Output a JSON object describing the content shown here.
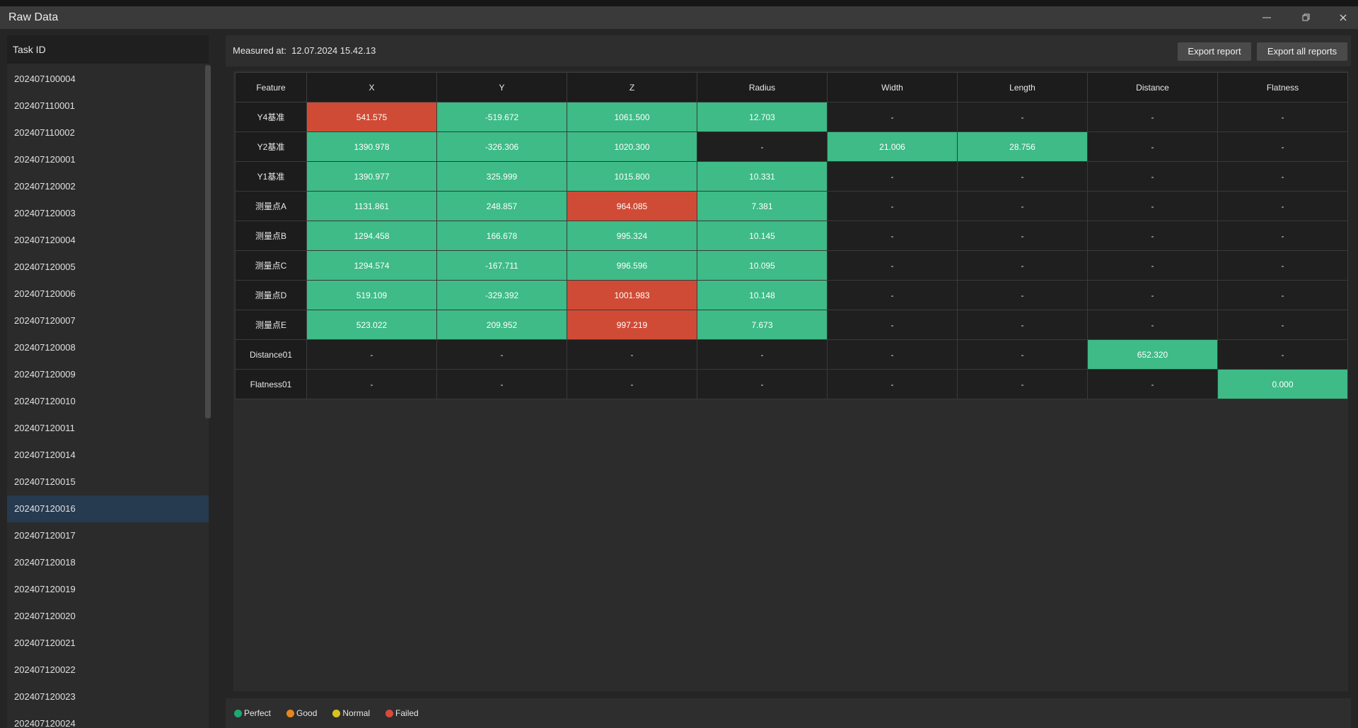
{
  "window": {
    "title": "Raw Data",
    "controls": [
      "minimize-icon",
      "restore-icon",
      "close-icon"
    ]
  },
  "sidebar": {
    "header": "Task ID",
    "selected": "202407120016",
    "items": [
      "202407100004",
      "202407110001",
      "202407110002",
      "202407120001",
      "202407120002",
      "202407120003",
      "202407120004",
      "202407120005",
      "202407120006",
      "202407120007",
      "202407120008",
      "202407120009",
      "202407120010",
      "202407120011",
      "202407120014",
      "202407120015",
      "202407120016",
      "202407120017",
      "202407120018",
      "202407120019",
      "202407120020",
      "202407120021",
      "202407120022",
      "202407120023",
      "202407120024"
    ]
  },
  "header": {
    "measured_label": "Measured at:",
    "measured_value": "12.07.2024 15.42.13",
    "export_report": "Export report",
    "export_all": "Export all reports"
  },
  "table": {
    "columns": [
      "Feature",
      "X",
      "Y",
      "Z",
      "Radius",
      "Width",
      "Length",
      "Distance",
      "Flatness"
    ],
    "rows": [
      {
        "feature": "Y4基准",
        "cells": [
          [
            "541.575",
            "failed"
          ],
          [
            "-519.672",
            "perfect"
          ],
          [
            "1061.500",
            "perfect"
          ],
          [
            "12.703",
            "perfect"
          ],
          [
            "-",
            ""
          ],
          [
            "-",
            ""
          ],
          [
            "-",
            ""
          ],
          [
            "-",
            ""
          ]
        ]
      },
      {
        "feature": "Y2基准",
        "cells": [
          [
            "1390.978",
            "perfect"
          ],
          [
            "-326.306",
            "perfect"
          ],
          [
            "1020.300",
            "perfect"
          ],
          [
            "-",
            ""
          ],
          [
            "21.006",
            "perfect"
          ],
          [
            "28.756",
            "perfect"
          ],
          [
            "-",
            ""
          ],
          [
            "-",
            ""
          ]
        ]
      },
      {
        "feature": "Y1基准",
        "cells": [
          [
            "1390.977",
            "perfect"
          ],
          [
            "325.999",
            "perfect"
          ],
          [
            "1015.800",
            "perfect"
          ],
          [
            "10.331",
            "perfect"
          ],
          [
            "-",
            ""
          ],
          [
            "-",
            ""
          ],
          [
            "-",
            ""
          ],
          [
            "-",
            ""
          ]
        ]
      },
      {
        "feature": "测量点A",
        "cells": [
          [
            "1131.861",
            "perfect"
          ],
          [
            "248.857",
            "perfect"
          ],
          [
            "964.085",
            "failed"
          ],
          [
            "7.381",
            "perfect"
          ],
          [
            "-",
            ""
          ],
          [
            "-",
            ""
          ],
          [
            "-",
            ""
          ],
          [
            "-",
            ""
          ]
        ]
      },
      {
        "feature": "测量点B",
        "cells": [
          [
            "1294.458",
            "perfect"
          ],
          [
            "166.678",
            "perfect"
          ],
          [
            "995.324",
            "perfect"
          ],
          [
            "10.145",
            "perfect"
          ],
          [
            "-",
            ""
          ],
          [
            "-",
            ""
          ],
          [
            "-",
            ""
          ],
          [
            "-",
            ""
          ]
        ]
      },
      {
        "feature": "测量点C",
        "cells": [
          [
            "1294.574",
            "perfect"
          ],
          [
            "-167.711",
            "perfect"
          ],
          [
            "996.596",
            "perfect"
          ],
          [
            "10.095",
            "perfect"
          ],
          [
            "-",
            ""
          ],
          [
            "-",
            ""
          ],
          [
            "-",
            ""
          ],
          [
            "-",
            ""
          ]
        ]
      },
      {
        "feature": "测量点D",
        "cells": [
          [
            "519.109",
            "perfect"
          ],
          [
            "-329.392",
            "perfect"
          ],
          [
            "1001.983",
            "failed"
          ],
          [
            "10.148",
            "perfect"
          ],
          [
            "-",
            ""
          ],
          [
            "-",
            ""
          ],
          [
            "-",
            ""
          ],
          [
            "-",
            ""
          ]
        ]
      },
      {
        "feature": "测量点E",
        "cells": [
          [
            "523.022",
            "perfect"
          ],
          [
            "209.952",
            "perfect"
          ],
          [
            "997.219",
            "failed"
          ],
          [
            "7.673",
            "perfect"
          ],
          [
            "-",
            ""
          ],
          [
            "-",
            ""
          ],
          [
            "-",
            ""
          ],
          [
            "-",
            ""
          ]
        ]
      },
      {
        "feature": "Distance01",
        "cells": [
          [
            "-",
            ""
          ],
          [
            "-",
            ""
          ],
          [
            "-",
            ""
          ],
          [
            "-",
            ""
          ],
          [
            "-",
            ""
          ],
          [
            "-",
            ""
          ],
          [
            "652.320",
            "perfect"
          ],
          [
            "-",
            ""
          ]
        ]
      },
      {
        "feature": "Flatness01",
        "cells": [
          [
            "-",
            ""
          ],
          [
            "-",
            ""
          ],
          [
            "-",
            ""
          ],
          [
            "-",
            ""
          ],
          [
            "-",
            ""
          ],
          [
            "-",
            ""
          ],
          [
            "-",
            ""
          ],
          [
            "0.000",
            "perfect"
          ]
        ]
      }
    ]
  },
  "legend": [
    {
      "label": "Perfect",
      "color": "#1fa86f"
    },
    {
      "label": "Good",
      "color": "#e8861c"
    },
    {
      "label": "Normal",
      "color": "#d7c51d"
    },
    {
      "label": "Failed",
      "color": "#d94a3a"
    }
  ],
  "colors": {
    "perfect": "#3ebb86",
    "failed": "#d04b35",
    "selected_row": "#263a50"
  }
}
